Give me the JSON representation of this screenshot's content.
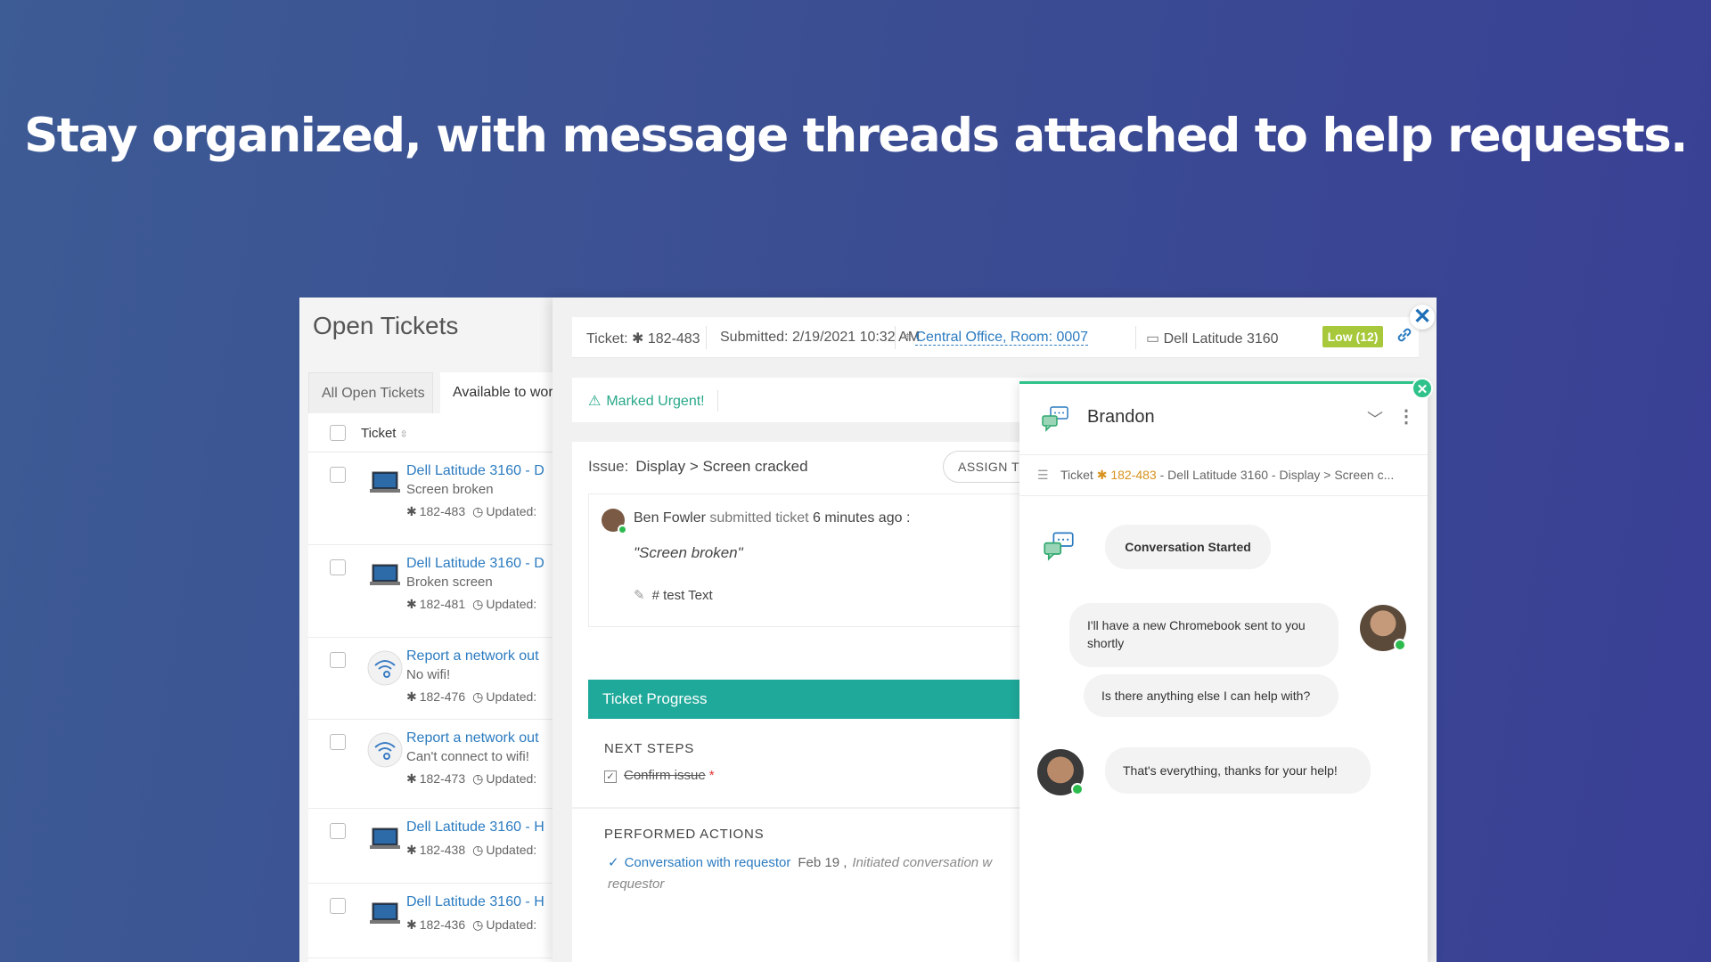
{
  "headline": "Stay organized, with message threads attached to help requests.",
  "left_panel": {
    "title": "Open Tickets",
    "tabs": [
      "All Open Tickets",
      "Available to wor"
    ],
    "column_header": "Ticket",
    "updated_label": "Updated:",
    "rows": [
      {
        "icon": "laptop-icon",
        "title": "Dell Latitude 3160 - D",
        "subtitle": "Screen broken",
        "ticket": "182-483"
      },
      {
        "icon": "laptop-icon",
        "title": "Dell Latitude 3160 - D",
        "subtitle": "Broken screen",
        "ticket": "182-481"
      },
      {
        "icon": "wifi-icon",
        "title": "Report a network out",
        "subtitle": "No wifi!",
        "ticket": "182-476"
      },
      {
        "icon": "wifi-icon",
        "title": "Report a network out",
        "subtitle": "Can't connect to wifi!",
        "ticket": "182-473"
      },
      {
        "icon": "laptop-icon",
        "title": "Dell Latitude 3160 - H",
        "subtitle": "",
        "ticket": "182-438"
      },
      {
        "icon": "laptop-icon",
        "title": "Dell Latitude 3160 - H",
        "subtitle": "",
        "ticket": "182-436"
      }
    ]
  },
  "ticket": {
    "label": "Ticket:",
    "number": "182-483",
    "submitted_label": "Submitted:",
    "submitted": "2/19/2021 10:32 AM",
    "location": "Central Office, Room: 0007",
    "device": "Dell Latitude 3160",
    "priority": "Low (12)",
    "urgent": "Marked Urgent!",
    "issue_label": "Issue:",
    "issue": "Display > Screen cracked",
    "assign_button": "ASSIGN TO M",
    "submitter": "Ben Fowler",
    "submitted_text": "submitted ticket",
    "submitted_ago": "6 minutes ago :",
    "quote": "\"Screen broken\"",
    "note": "# test Text",
    "progress_title": "Ticket Progress",
    "next_steps_label": "NEXT STEPS",
    "next_step": "Confirm issue",
    "required_mark": "*",
    "performed_label": "PERFORMED ACTIONS",
    "action": "Conversation with requestor",
    "action_date": "Feb 19 ,",
    "action_desc": "Initiated conversation w",
    "action_desc2": "requestor"
  },
  "chat": {
    "name": "Brandon",
    "ticket_prefix": "Ticket",
    "ticket_number": "182-483",
    "ticket_desc": "- Dell Latitude 3160 - Display > Screen c...",
    "system_message": "Conversation Started",
    "messages": [
      "I'll have a new Chromebook sent to you shortly",
      "Is there anything else I can help with?",
      "That's everything, thanks for your help!"
    ]
  },
  "colors": {
    "accent_teal": "#1fa99a",
    "link_blue": "#2b7bc0",
    "priority_green": "#a7c83a",
    "online_green": "#2dbb4e",
    "ticket_orange": "#d7921d"
  }
}
